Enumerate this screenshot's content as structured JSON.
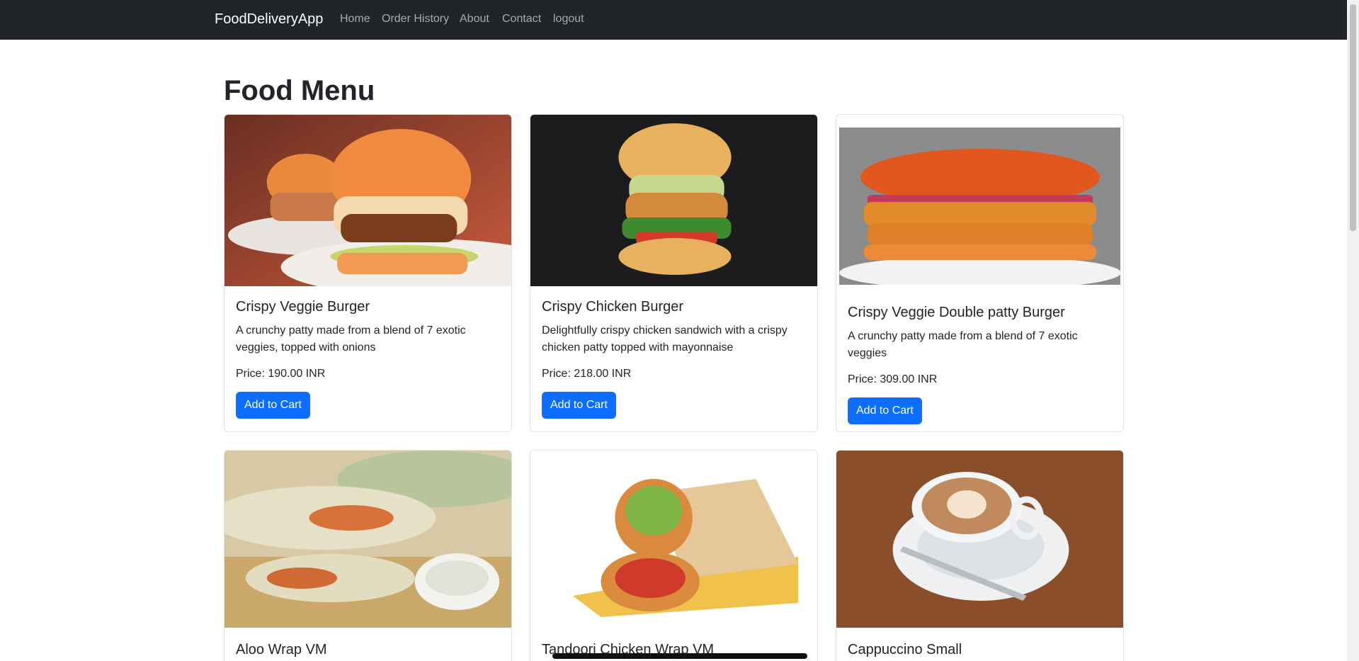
{
  "navbar": {
    "brand": "FoodDeliveryApp",
    "links": [
      "Home",
      "Order History",
      "About",
      "Contact",
      "logout"
    ]
  },
  "page": {
    "title": "Food Menu"
  },
  "menu": {
    "items": [
      {
        "name": "Crispy Veggie Burger",
        "description": "A crunchy patty made from a blend of 7 exotic veggies, topped with onions",
        "price": "Price: 190.00 INR",
        "button": "Add to Cart",
        "image": "veggie-burger-image"
      },
      {
        "name": "Crispy Chicken Burger",
        "description": "Delightfully crispy chicken sandwich with a crispy chicken patty topped with mayonnaise",
        "price": "Price: 218.00 INR",
        "button": "Add to Cart",
        "image": "chicken-burger-image"
      },
      {
        "name": "Crispy Veggie Double patty Burger",
        "description": "A crunchy patty made from a blend of 7 exotic veggies",
        "price": "Price: 309.00 INR",
        "button": "Add to Cart",
        "image": "double-patty-burger-image"
      },
      {
        "name": "Aloo Wrap VM",
        "image": "aloo-wrap-image"
      },
      {
        "name": "Tandoori Chicken Wrap VM",
        "image": "tandoori-wrap-image"
      },
      {
        "name": "Cappuccino Small",
        "image": "cappuccino-image"
      }
    ]
  },
  "colors": {
    "navbar": "#212529",
    "primary": "#0d6efd",
    "border": "#dee2e6"
  }
}
